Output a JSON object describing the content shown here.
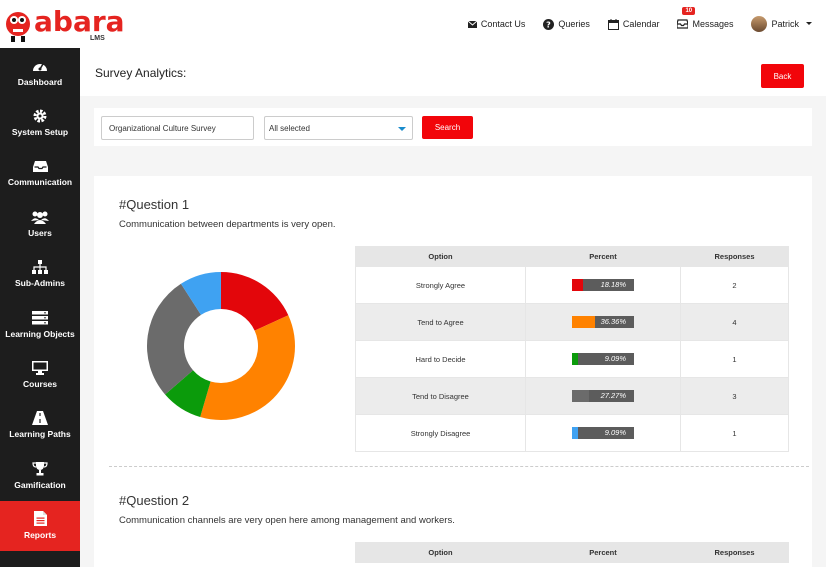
{
  "brand": {
    "logo_text": "abara",
    "logo_sub": "LMS"
  },
  "topnav": {
    "contact": "Contact Us",
    "queries": "Queries",
    "calendar": "Calendar",
    "messages": "Messages",
    "messages_badge": "10",
    "user": "Patrick"
  },
  "sidebar": {
    "items": [
      {
        "label": "Dashboard",
        "icon": "dashboard-icon"
      },
      {
        "label": "System Setup",
        "icon": "gear-icon"
      },
      {
        "label": "Communication",
        "icon": "inbox-icon"
      },
      {
        "label": "Users",
        "icon": "users-icon"
      },
      {
        "label": "Sub-Admins",
        "icon": "sitemap-icon"
      },
      {
        "label": "Learning Objects",
        "icon": "server-icon"
      },
      {
        "label": "Courses",
        "icon": "monitor-icon"
      },
      {
        "label": "Learning Paths",
        "icon": "road-icon"
      },
      {
        "label": "Gamification",
        "icon": "trophy-icon"
      },
      {
        "label": "Reports",
        "icon": "report-icon",
        "active": true
      }
    ]
  },
  "page": {
    "title": "Survey Analytics:",
    "back_label": "Back"
  },
  "filters": {
    "survey_value": "Organizational Culture Survey",
    "select_value": "All selected",
    "search_label": "Search"
  },
  "table_headers": {
    "option": "Option",
    "percent": "Percent",
    "responses": "Responses"
  },
  "questions": [
    {
      "title": "#Question 1",
      "text": "Communication between departments is very open.",
      "rows": [
        {
          "option": "Strongly Agree",
          "percent": "18.18%",
          "fraction": 0.1818,
          "responses": "2",
          "color": "#e3060b"
        },
        {
          "option": "Tend to Agree",
          "percent": "36.36%",
          "fraction": 0.3636,
          "responses": "4",
          "color": "#ff8200"
        },
        {
          "option": "Hard to Decide",
          "percent": "9.09%",
          "fraction": 0.0909,
          "responses": "1",
          "color": "#0b9b0b"
        },
        {
          "option": "Tend to Disagree",
          "percent": "27.27%",
          "fraction": 0.2727,
          "responses": "3",
          "color": "#6b6b6b"
        },
        {
          "option": "Strongly Disagree",
          "percent": "9.09%",
          "fraction": 0.0909,
          "responses": "1",
          "color": "#3fa2f2"
        }
      ]
    },
    {
      "title": "#Question 2",
      "text": "Communication channels are very open here among management and workers."
    }
  ]
}
